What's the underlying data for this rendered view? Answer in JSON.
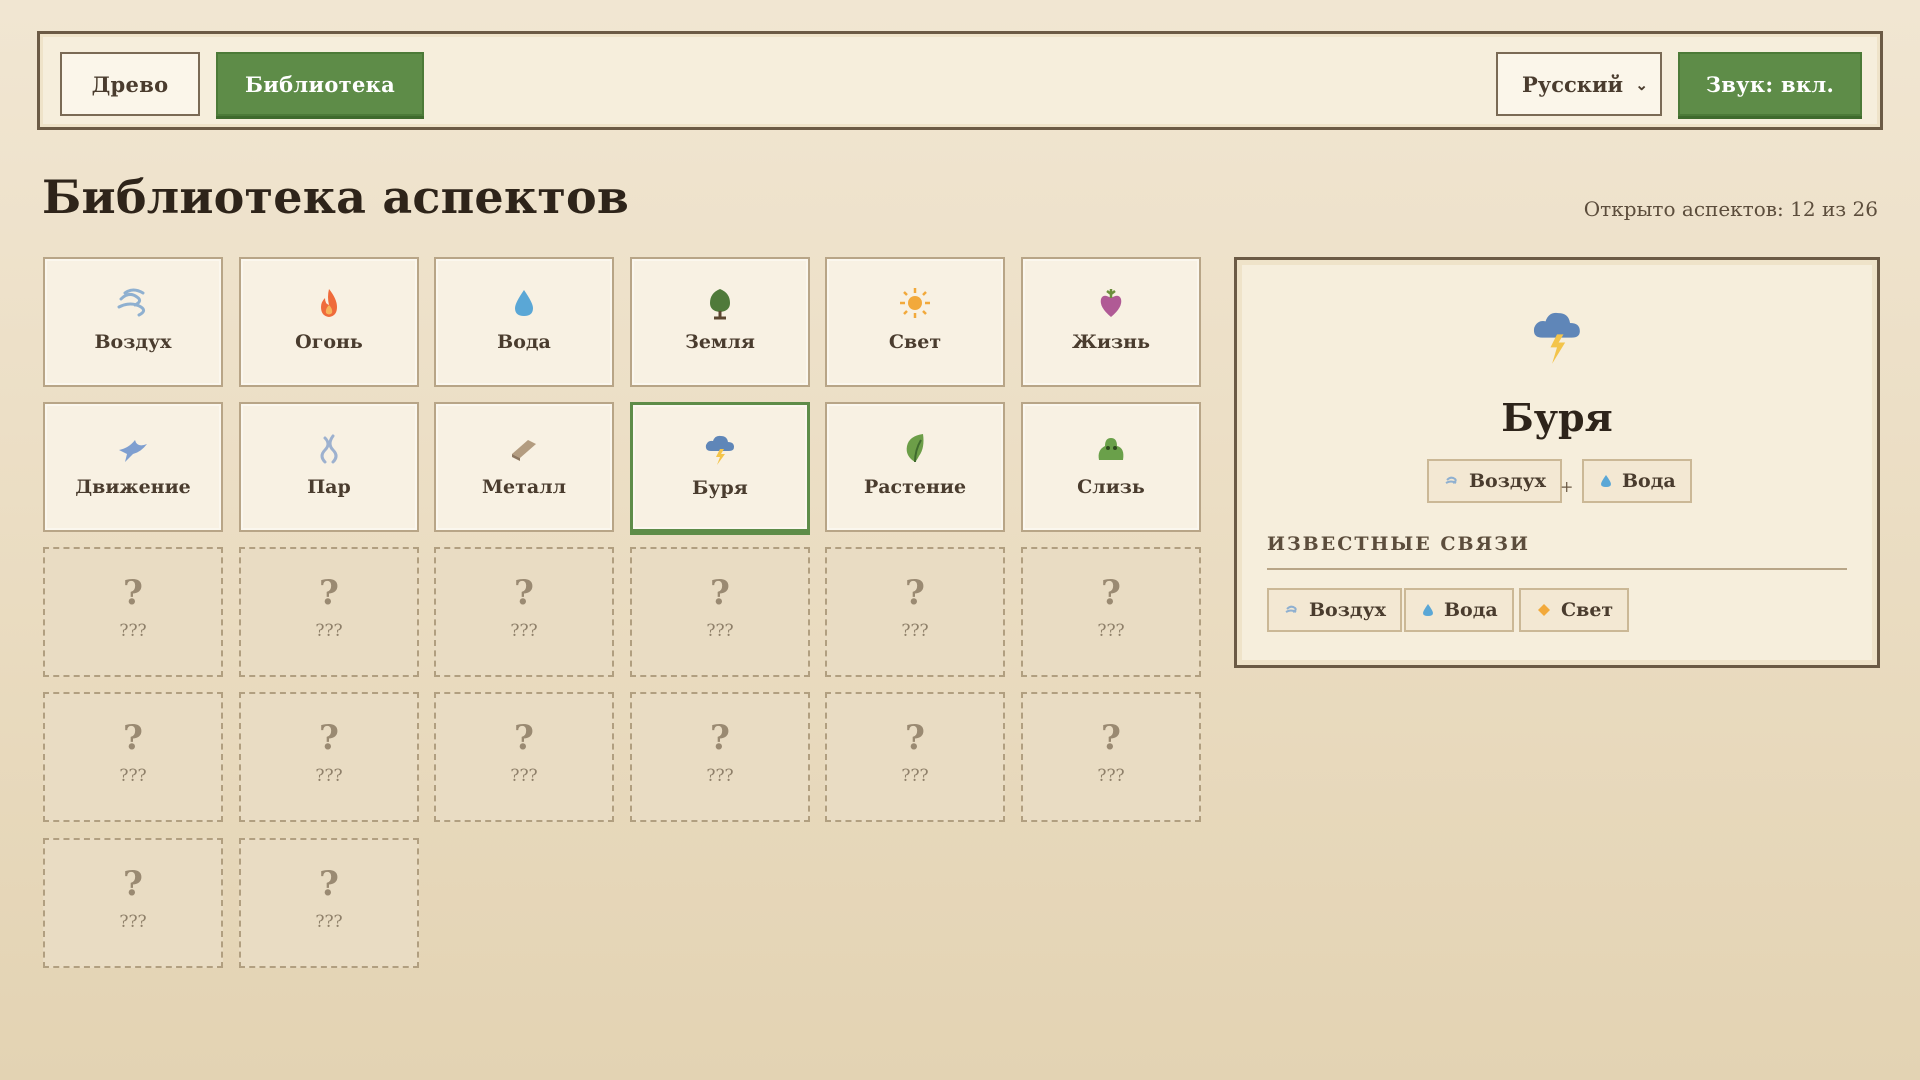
{
  "topbar": {
    "tree_label": "Древо",
    "library_label": "Библиотека",
    "language": "Русский",
    "sound_label": "Звук: вкл."
  },
  "page": {
    "title": "Библиотека аспектов",
    "counter": "Открыто аспектов: 12 из 26"
  },
  "aspects": [
    {
      "name": "Воздух",
      "icon": "air-icon"
    },
    {
      "name": "Огонь",
      "icon": "fire-icon"
    },
    {
      "name": "Вода",
      "icon": "water-icon"
    },
    {
      "name": "Земля",
      "icon": "earth-icon"
    },
    {
      "name": "Свет",
      "icon": "light-icon"
    },
    {
      "name": "Жизнь",
      "icon": "life-icon"
    },
    {
      "name": "Движение",
      "icon": "motion-icon"
    },
    {
      "name": "Пар",
      "icon": "steam-icon"
    },
    {
      "name": "Металл",
      "icon": "metal-icon"
    },
    {
      "name": "Буря",
      "icon": "storm-icon",
      "selected": true
    },
    {
      "name": "Растение",
      "icon": "plant-icon"
    },
    {
      "name": "Слизь",
      "icon": "slime-icon"
    }
  ],
  "locked": {
    "symbol": "?",
    "name": "???",
    "count": 14
  },
  "detail": {
    "name": "Буря",
    "icon": "storm-icon",
    "recipe": [
      "Воздух",
      "Вода"
    ],
    "plus": "+",
    "known_title": "ИЗВЕСТНЫЕ СВЯЗИ",
    "known": [
      "Воздух",
      "Вода",
      "Свет"
    ]
  },
  "colors": {
    "accent_green": "#5e8c48",
    "background": "#eadcc1",
    "panel": "#f6eedc",
    "border": "#6b5a45"
  }
}
